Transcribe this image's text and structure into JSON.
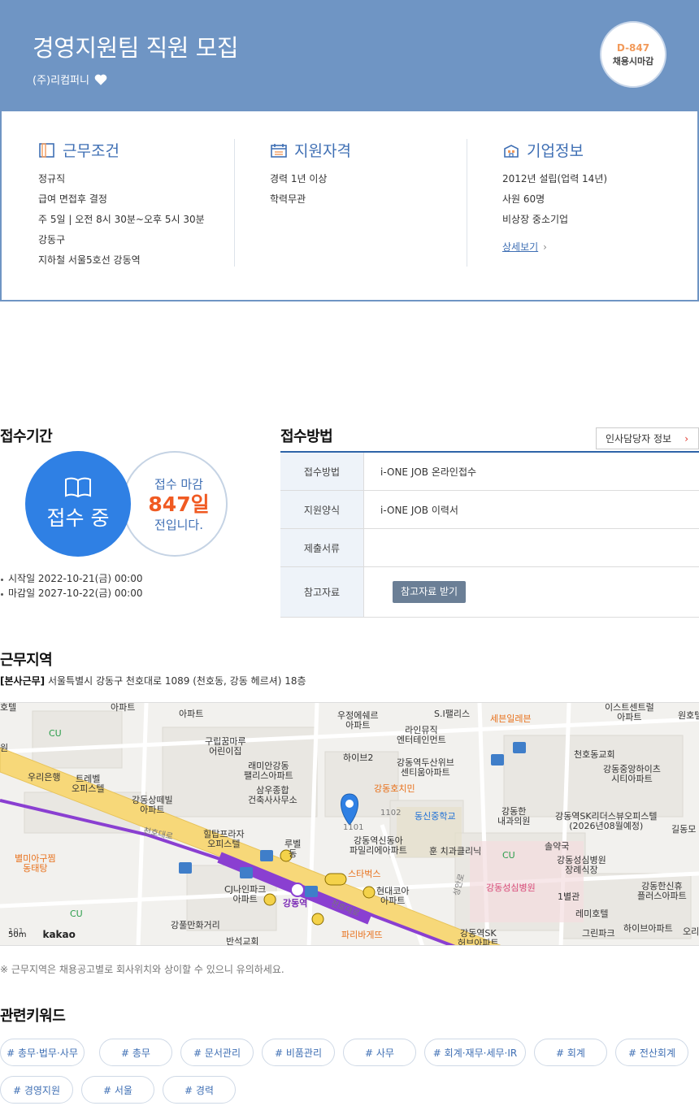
{
  "hero": {
    "title": "경영지원팀 직원 모집",
    "company": "(주)리컴퍼니",
    "dday": "D-847",
    "dday_label": "채용시마감",
    "background": "#6f95c4"
  },
  "summary": {
    "work_conditions": {
      "title": "근무조건",
      "items": [
        "정규직",
        "급여 면접후 결정",
        "주 5일 | 오전 8시 30분~오후 5시 30분",
        "강동구",
        "지하철 서울5호선 강동역"
      ]
    },
    "qualifications": {
      "title": "지원자격",
      "items": [
        "경력 1년 이상",
        "학력무관"
      ]
    },
    "company_info": {
      "title": "기업정보",
      "items": [
        "2012년 설립(업력 14년)",
        "사원 60명",
        "비상장 중소기업"
      ],
      "link": "상세보기"
    }
  },
  "period": {
    "section_title": "접수기간",
    "status": "접수 중",
    "deadline_label": "접수 마감",
    "deadline_days": "847일",
    "deadline_suffix": "전입니다.",
    "start": "시작일 2022-10-21(금) 00:00",
    "end": "마감일 2027-10-22(금) 00:00"
  },
  "method": {
    "section_title": "접수방법",
    "hr_button": "인사담당자 정보",
    "rows": [
      {
        "label": "접수방법",
        "value": "i-ONE JOB 온라인접수"
      },
      {
        "label": "지원양식",
        "value": "i-ONE JOB 이력서"
      },
      {
        "label": "제출서류",
        "value": ""
      },
      {
        "label": "참고자료",
        "button": "참고자료 받기"
      }
    ]
  },
  "location": {
    "section_title": "근무지역",
    "office_tag": "[본사근무]",
    "address": "서울특별시 강동구 천호대로 1089 (천호동, 강동 헤르셔) 18층",
    "map_labels": {
      "l1": "구립꿈마루\n어린이집",
      "l2": "래미안강동\n팰리스아파트",
      "l3": "삼우종합\n건축사사무소",
      "l4": "힐탑프라자\n오피스텔",
      "l5": "트레벨\n오피스텔",
      "l6": "강동상떼빌\n아파트",
      "l7": "우리은행",
      "l8": "별미아구찜\n동태탕",
      "l9": "CJ나인파크\n아파트",
      "l10": "강풀만화거리",
      "l11": "반석교회",
      "l12": "강동역",
      "l13": "하이브2",
      "l14": "강동호치민",
      "l15": "강동역신동아\n파밀리에아파트",
      "l16": "스타벅스",
      "l17": "현대코아\n아파트",
      "l18": "파리바게뜨",
      "l19": "동신중학교",
      "l20": "훈 치과클리닉",
      "l21": "강동역두산위브\n센티움아파트",
      "l22": "라인뮤직\n엔터테인먼트",
      "l23": "우정에쉐르\n아파트",
      "l24": "S.I팰리스",
      "l25": "세븐일레븐",
      "l26": "천호동교회",
      "l27": "강동중앙하이츠\n시티아파트",
      "l28": "강동한\n내과의원",
      "l29": "강동역SK리더스뷰오피스텔\n(2026년08월예정)",
      "l30": "솔약국",
      "l31": "강동성심병원\n장례식장",
      "l32": "강동성심병원",
      "l33": "1별관",
      "l34": "레미호텔",
      "l35": "그린파크",
      "l36": "강동한신휴\n플러스아파트",
      "l37": "하이브아파트",
      "l38": "강동역SK\n허브아파트",
      "l39": "길동모",
      "l40": "천호대로",
      "l41": "천호대로",
      "l42": "성안로",
      "l43": "CU",
      "l44": "CU",
      "l45": "CU",
      "l46": "1101",
      "l47": "1102",
      "l48": "아파트",
      "l49": "아파트",
      "l50": "원호텔",
      "l51": "호텔",
      "l52": "원",
      "l53": "101",
      "l54": "이스트센트럴\n아파트",
      "l55": "오리",
      "l56": "루벨\n동"
    },
    "map_scale": "50m",
    "map_logo": "kakao",
    "note": "※ 근무지역은 채용공고별로 회사위치와 상이할 수 있으니 유의하세요."
  },
  "keywords": {
    "section_title": "관련키워드",
    "items": [
      "# 총무·법무·사무",
      "# 총무",
      "# 문서관리",
      "# 비품관리",
      "# 사무",
      "# 회계·재무·세무·IR",
      "# 회계",
      "# 전산회계",
      "# 경영지원",
      "# 서울",
      "# 경력"
    ]
  }
}
